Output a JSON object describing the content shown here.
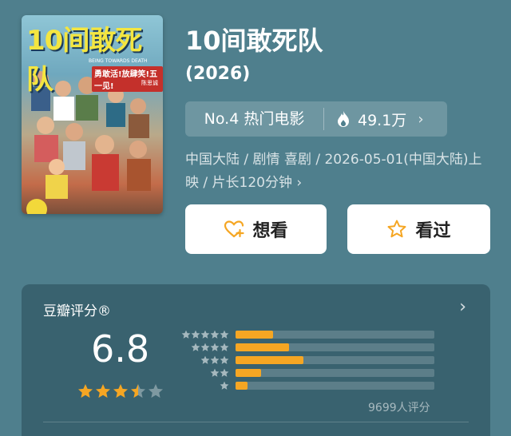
{
  "poster": {
    "title": "10间敢死队",
    "subtitle": "BEING TOWARDS DEATH",
    "tagline": "勇敢活!放肆笑!五一见!",
    "director": "陈思诚"
  },
  "movie": {
    "title": "10间敢死队",
    "year": "(2026)",
    "rank": "No.4 热门电影",
    "heat": "49.1万",
    "meta": "中国大陆 / 剧情 喜剧 / 2026-05-01(中国大陆)上映 / 片长120分钟 ›"
  },
  "actions": {
    "want": "想看",
    "seen": "看过"
  },
  "rating": {
    "title": "豆瓣评分®",
    "score": "6.8",
    "stars_filled": 3.5,
    "count": "9699人评分",
    "distribution": [
      {
        "stars": 5,
        "fraction": 0.19
      },
      {
        "stars": 4,
        "fraction": 0.27
      },
      {
        "stars": 3,
        "fraction": 0.34
      },
      {
        "stars": 2,
        "fraction": 0.13
      },
      {
        "stars": 1,
        "fraction": 0.06
      }
    ]
  },
  "colors": {
    "background": "#4f7f8d",
    "accent": "#f5a623",
    "heart": "#f5a623"
  }
}
